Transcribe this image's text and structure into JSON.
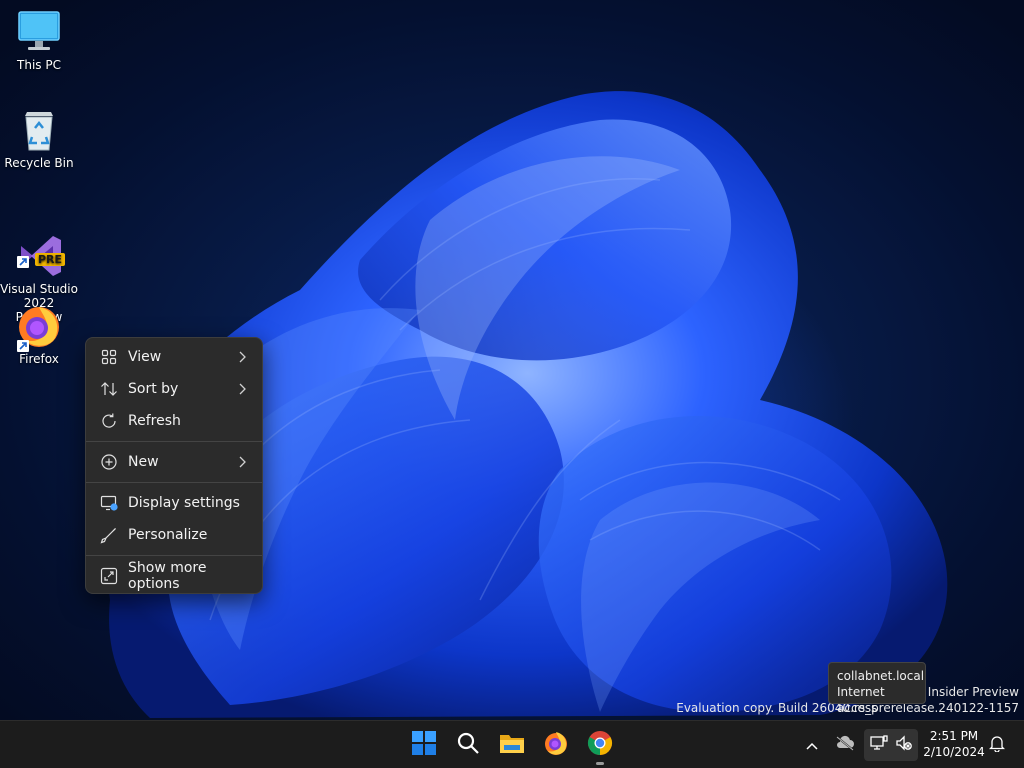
{
  "desktop": {
    "icons": [
      {
        "label": "This PC",
        "icon": "monitor-icon"
      },
      {
        "label": "Recycle Bin",
        "icon": "recycle-bin-icon"
      },
      {
        "label": "Visual Studio\n2022 Preview",
        "icon": "visual-studio-icon",
        "badge": "PRE"
      },
      {
        "label": "Firefox",
        "icon": "firefox-icon"
      }
    ]
  },
  "context_menu": {
    "items": [
      {
        "label": "View",
        "icon": "grid-icon",
        "submenu": true
      },
      {
        "label": "Sort by",
        "icon": "sort-icon",
        "submenu": true
      },
      {
        "label": "Refresh",
        "icon": "refresh-icon",
        "submenu": false
      },
      {
        "label": "New",
        "icon": "plus-circle-icon",
        "submenu": true
      },
      {
        "label": "Display settings",
        "icon": "display-settings-icon",
        "submenu": false
      },
      {
        "label": "Personalize",
        "icon": "brush-icon",
        "submenu": false
      },
      {
        "label": "Show more options",
        "icon": "expand-icon",
        "submenu": false
      }
    ]
  },
  "watermark": {
    "line1": "ro Insider Preview",
    "line2": "Evaluation copy. Build 26040.rs_prerelease.240122-1157"
  },
  "tooltip": {
    "line1": "collabnet.local",
    "line2": "Internet access"
  },
  "taskbar": {
    "apps": [
      "start-icon",
      "search-icon",
      "file-explorer-icon",
      "firefox-icon",
      "chrome-icon"
    ],
    "clock": {
      "time": "2:51 PM",
      "date": "2/10/2024"
    }
  },
  "colors": {
    "taskbar_bg": "#1c1c1c",
    "menu_bg": "#2b2b2b",
    "accent_blue": "#1f5cff"
  }
}
